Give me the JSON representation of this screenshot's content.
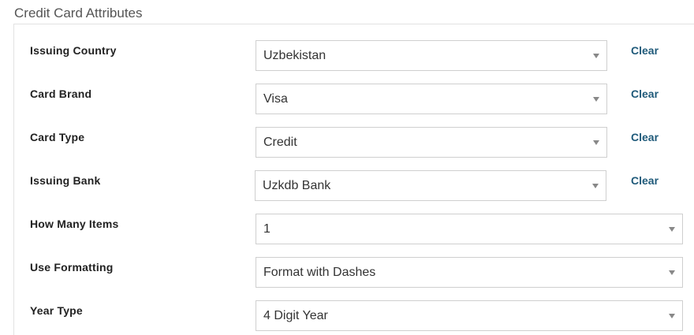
{
  "section": {
    "title": "Credit Card Attributes"
  },
  "fields": [
    {
      "label": "Issuing Country",
      "value": "Uzbekistan",
      "clear": "Clear"
    },
    {
      "label": "Card Brand",
      "value": "Visa",
      "clear": "Clear"
    },
    {
      "label": "Card Type",
      "value": "Credit",
      "clear": "Clear"
    },
    {
      "label": "Issuing Bank",
      "value": "Uzkdb Bank",
      "clear": "Clear"
    },
    {
      "label": "How Many Items",
      "value": "1"
    },
    {
      "label": "Use Formatting",
      "value": "Format with Dashes"
    },
    {
      "label": "Year Type",
      "value": "4 Digit Year"
    }
  ],
  "icons": {
    "dropdown": "chevron-down-icon"
  },
  "colors": {
    "link": "#1f5a7a",
    "label": "#222222",
    "border": "#cfcfcf"
  }
}
